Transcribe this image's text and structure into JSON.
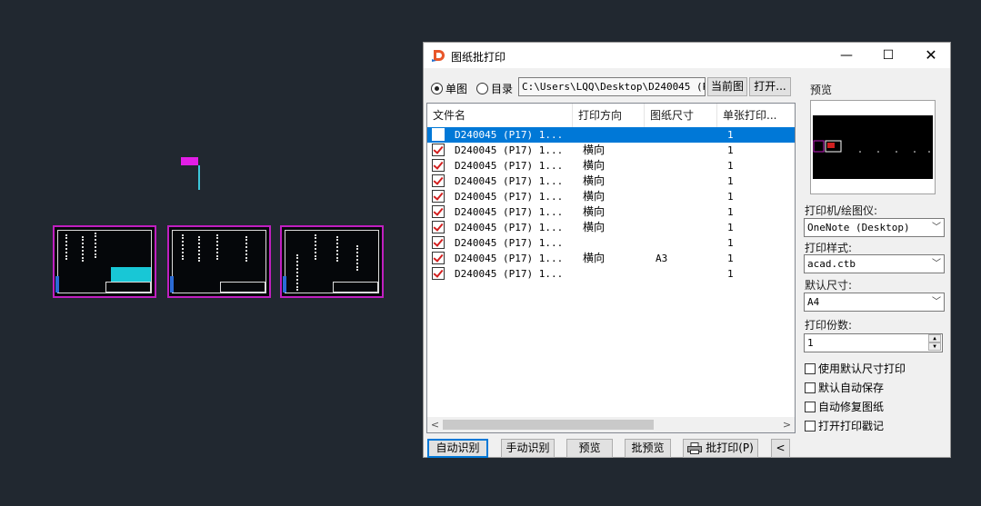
{
  "dialog": {
    "title": "图纸批打印",
    "minimize": "—",
    "maximize": "☐",
    "close": "✕",
    "mode_single": "单图",
    "mode_dir": "目录",
    "path": "C:\\Users\\LQQ\\Desktop\\D240045 (P17",
    "btn_current": "当前图",
    "btn_open": "打开...",
    "columns": [
      "文件名",
      "打印方向",
      "图纸尺寸",
      "单张打印..."
    ],
    "rows": [
      {
        "name": "D240045 (P17) 1...",
        "dir": "",
        "size": "",
        "copies": "1",
        "checked": false,
        "selected": true
      },
      {
        "name": "D240045 (P17) 1...",
        "dir": "横向",
        "size": "",
        "copies": "1",
        "checked": true,
        "selected": false
      },
      {
        "name": "D240045 (P17) 1...",
        "dir": "横向",
        "size": "",
        "copies": "1",
        "checked": true,
        "selected": false
      },
      {
        "name": "D240045 (P17) 1...",
        "dir": "横向",
        "size": "",
        "copies": "1",
        "checked": true,
        "selected": false
      },
      {
        "name": "D240045 (P17) 1...",
        "dir": "横向",
        "size": "",
        "copies": "1",
        "checked": true,
        "selected": false
      },
      {
        "name": "D240045 (P17) 1...",
        "dir": "横向",
        "size": "",
        "copies": "1",
        "checked": true,
        "selected": false
      },
      {
        "name": "D240045 (P17) 1...",
        "dir": "横向",
        "size": "",
        "copies": "1",
        "checked": true,
        "selected": false
      },
      {
        "name": "D240045 (P17) 1...",
        "dir": "",
        "size": "",
        "copies": "1",
        "checked": true,
        "selected": false
      },
      {
        "name": "D240045 (P17) 1...",
        "dir": "横向",
        "size": "A3",
        "copies": "1",
        "checked": true,
        "selected": false
      },
      {
        "name": "D240045 (P17) 1...",
        "dir": "",
        "size": "",
        "copies": "1",
        "checked": true,
        "selected": false
      }
    ],
    "preview_label": "预览",
    "printer_label": "打印机/绘图仪:",
    "printer_value": "OneNote (Desktop)",
    "style_label": "打印样式:",
    "style_value": "acad.ctb",
    "size_label": "默认尺寸:",
    "size_value": "A4",
    "copies_label": "打印份数:",
    "copies_value": "1",
    "options": [
      "使用默认尺寸打印",
      "默认自动保存",
      "自动修复图纸",
      "打开打印戳记"
    ],
    "buttons": {
      "auto": "自动识别",
      "manual": "手动识别",
      "preview": "预览",
      "batch_preview": "批预览",
      "batch_print": "批打印(P)",
      "collapse": "<"
    },
    "scroll_left": "<",
    "scroll_right": ">"
  },
  "colors": {
    "canvas": "#212830",
    "selection": "#0078d7",
    "frame": "#c01fc0"
  }
}
